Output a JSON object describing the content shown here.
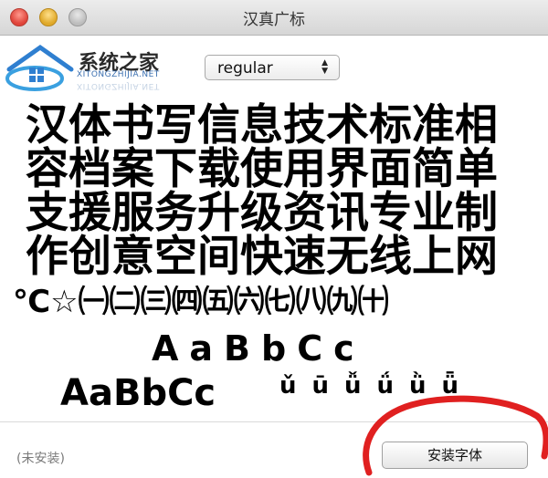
{
  "window": {
    "title": "汉真广标"
  },
  "watermark": {
    "title": "系统之家",
    "subtitle": "XITONGZHIJIA.NET"
  },
  "style_select": {
    "value": "regular"
  },
  "preview": {
    "hanzi_rows": [
      "汉体书写信息技术标准相",
      "容档案下载使用界面简单",
      "支援服务升级资讯专业制",
      "作创意空间快速无线上网"
    ],
    "symbols": "℃☆㈠㈡㈢㈣㈤㈥㈦㈧㈨㈩",
    "latin_spaced": "AaBbCc",
    "latin_tight": "AaBbCc",
    "pinyin": "ǔūǚǘǜǖ"
  },
  "footer": {
    "status": "(未安装)",
    "install_label": "安装字体"
  },
  "colors": {
    "annotation_circle": "#e02020"
  }
}
